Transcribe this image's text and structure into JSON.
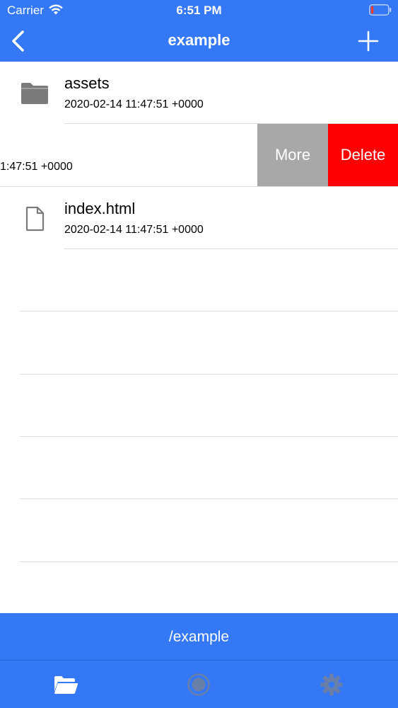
{
  "status_bar": {
    "carrier": "Carrier",
    "time": "6:51 PM",
    "wifi_icon": "wifi-icon",
    "battery_icon": "battery-low-icon"
  },
  "nav": {
    "title": "example",
    "back_icon": "chevron-left-icon",
    "add_icon": "plus-icon"
  },
  "files": [
    {
      "name": "assets",
      "date": "2020-02-14 11:47:51 +0000",
      "icon": "folder-icon"
    },
    {
      "name": "",
      "date": "1:47:51 +0000",
      "icon": ""
    },
    {
      "name": "index.html",
      "date": "2020-02-14 11:47:51 +0000",
      "icon": "document-icon"
    }
  ],
  "swipe_actions": {
    "more_label": "More",
    "delete_label": "Delete"
  },
  "path_bar": {
    "path": "/example"
  },
  "tab_bar": {
    "tabs": [
      {
        "icon": "folder-open-icon",
        "selected": true
      },
      {
        "icon": "record-icon",
        "selected": false
      },
      {
        "icon": "gear-icon",
        "selected": false
      }
    ]
  },
  "colors": {
    "accent": "#3478f6",
    "delete": "#fe0000",
    "more": "#a8a8a8",
    "icon_gray": "#7a7a7a",
    "tab_inactive": "#6a7fa8"
  }
}
